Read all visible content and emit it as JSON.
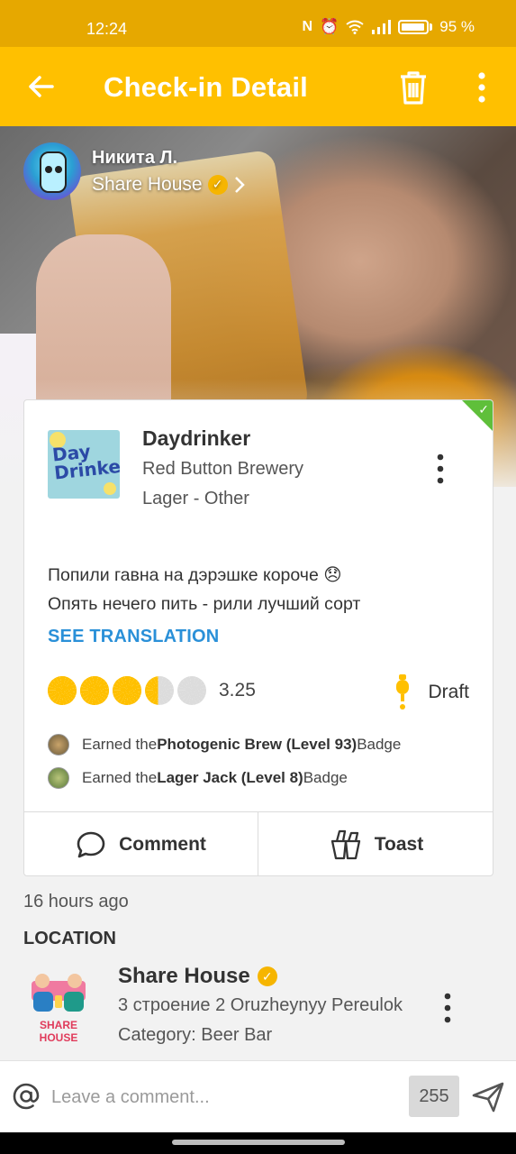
{
  "status_bar": {
    "time": "12:24",
    "battery": "95 %"
  },
  "app_bar": {
    "title": "Check-in Detail"
  },
  "user": {
    "name": "Никита Л.",
    "venue": "Share House"
  },
  "beer": {
    "name": "Daydrinker",
    "brewery": "Red Button Brewery",
    "style": "Lager - Other",
    "logo_text": "Day Drinker"
  },
  "checkin": {
    "comment_line1": "Попили гавна на дэрэшке короче 😞",
    "comment_line2": "Опять нечего пить - рили лучший сорт",
    "see_translation": "SEE TRANSLATION",
    "rating": 3.25,
    "rating_label": "3.25",
    "serving": "Draft",
    "badges": [
      {
        "prefix": "Earned the ",
        "name": "Photogenic Brew (Level 93)",
        "suffix": " Badge"
      },
      {
        "prefix": "Earned the ",
        "name": "Lager Jack (Level 8)",
        "suffix": " Badge"
      }
    ]
  },
  "actions": {
    "comment": "Comment",
    "toast": "Toast"
  },
  "time_ago": "16 hours ago",
  "location": {
    "header": "LOCATION",
    "name": "Share House",
    "address": "3 строение 2 Oruzheynyy Pereulok",
    "category": "Category: Beer Bar",
    "logo_text": "SHARE HOUSE"
  },
  "comment_bar": {
    "placeholder": "Leave a comment...",
    "char_count": "255"
  },
  "colors": {
    "accent": "#ffc000",
    "status_bar": "#e6a800",
    "link": "#2a90d8",
    "verified_check": "#5fbf3a"
  }
}
